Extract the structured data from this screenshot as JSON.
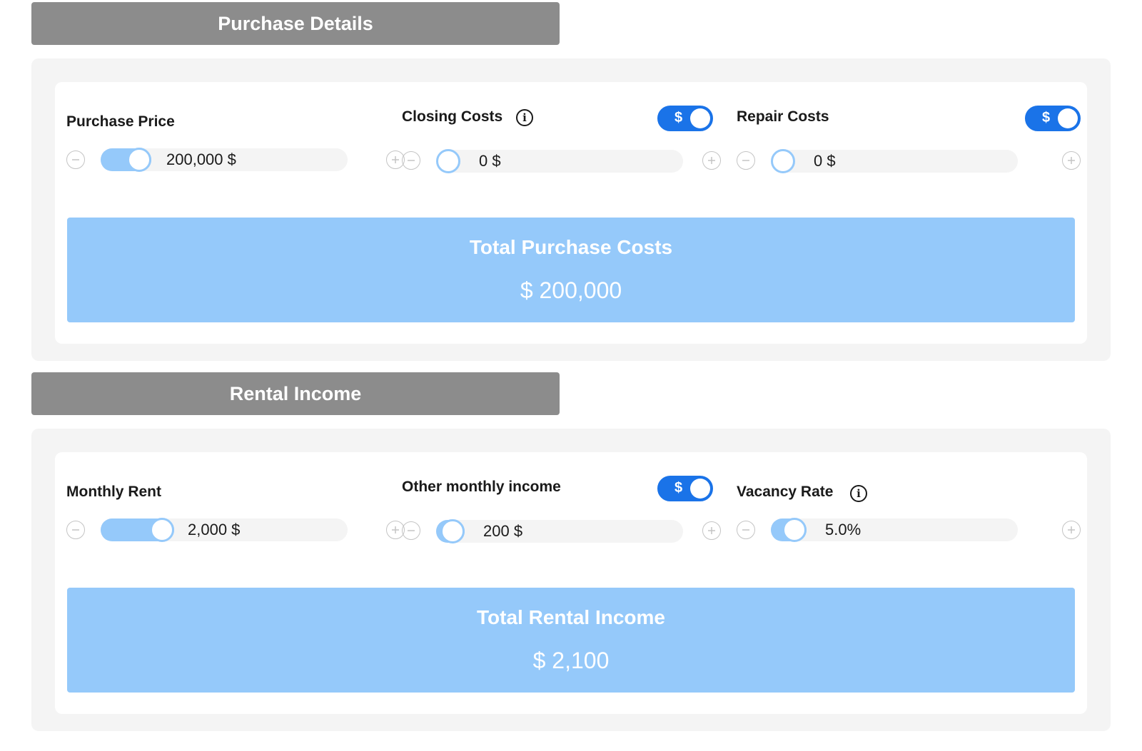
{
  "purchase": {
    "header": "Purchase Details",
    "fields": {
      "purchase_price": {
        "label": "Purchase Price",
        "value": "200,000 $",
        "fill_fraction": 0.12
      },
      "closing_costs": {
        "label": "Closing Costs",
        "value": "0 $",
        "toggle_label": "$",
        "fill_fraction": 0.0
      },
      "repair_costs": {
        "label": "Repair Costs",
        "value": "0 $",
        "toggle_label": "$",
        "fill_fraction": 0.0
      }
    },
    "total_label": "Total Purchase Costs",
    "total_value": "$ 200,000"
  },
  "rental": {
    "header": "Rental Income",
    "fields": {
      "monthly_rent": {
        "label": "Monthly Rent",
        "value": "2,000 $",
        "fill_fraction": 0.22
      },
      "other_income": {
        "label": "Other monthly income",
        "value": "200 $",
        "toggle_label": "$",
        "fill_fraction": 0.02
      },
      "vacancy_rate": {
        "label": "Vacancy Rate",
        "value": "5.0%",
        "fill_fraction": 0.05
      }
    },
    "total_label": "Total Rental Income",
    "total_value": "$ 2,100"
  },
  "icons": {
    "info": "info-icon",
    "minus": "minus-circle-icon",
    "plus": "plus-circle-icon"
  },
  "colors": {
    "header_bg": "#8c8c8c",
    "accent_blue": "#1a73e8",
    "light_blue": "#95c9fa",
    "panel_bg": "#f4f4f4"
  }
}
